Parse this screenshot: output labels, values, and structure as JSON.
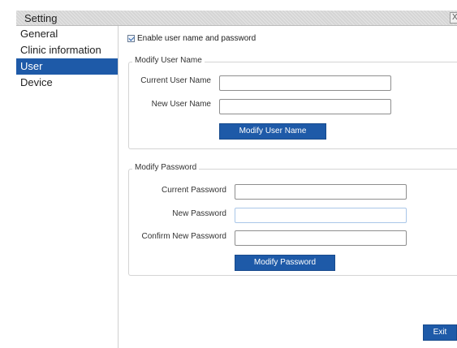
{
  "window": {
    "title": "Setting",
    "close_glyph": "X"
  },
  "sidebar": {
    "items": [
      {
        "label": "General",
        "active": false
      },
      {
        "label": "Clinic information",
        "active": false
      },
      {
        "label": "User",
        "active": true
      },
      {
        "label": "Device",
        "active": false
      }
    ]
  },
  "enable": {
    "label": "Enable user name and password",
    "checked": true
  },
  "modify_user": {
    "legend": "Modify User Name",
    "current_label": "Current User Name",
    "current_value": "",
    "new_label": "New User Name",
    "new_value": "",
    "button_label": "Modify User Name"
  },
  "modify_password": {
    "legend": "Modify Password",
    "current_label": "Current Password",
    "current_value": "",
    "new_label": "New Password",
    "new_value": "",
    "confirm_label": "Confirm New Password",
    "confirm_value": "",
    "button_label": "Modify Password"
  },
  "footer": {
    "exit_label": "Exit"
  },
  "colors": {
    "accent": "#1e5aa8",
    "titlebar": "#d5d5d5",
    "border": "#d4d4d4"
  }
}
